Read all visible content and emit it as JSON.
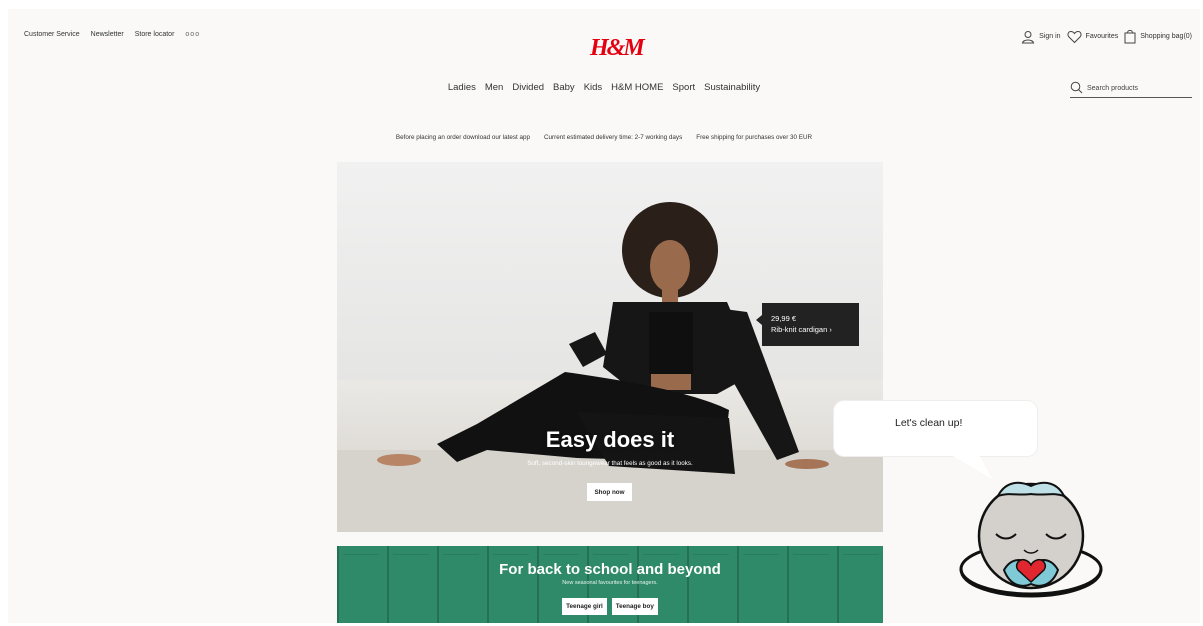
{
  "header": {
    "utility_links": [
      "Customer Service",
      "Newsletter",
      "Store locator"
    ],
    "more_label": "ooo",
    "logo": "H&M",
    "account": {
      "sign_in": "Sign in",
      "favourites": "Favourites",
      "shopping_bag": "Shopping bag(0)"
    },
    "nav": [
      "Ladies",
      "Men",
      "Divided",
      "Baby",
      "Kids",
      "H&M HOME",
      "Sport",
      "Sustainability"
    ],
    "search": {
      "placeholder": "Search products"
    }
  },
  "promo_bar": [
    "Before placing an order download our latest app",
    "Current estimated delivery time: 2-7 working days",
    "Free shipping for purchases over 30 EUR"
  ],
  "hero": {
    "title": "Easy does it",
    "subtitle": "Soft, second-skin loungewear that feels as good as it looks.",
    "cta": "Shop now",
    "price_tag": {
      "price": "29,99 €",
      "product": "Rib-knit cardigan ›"
    }
  },
  "banner2": {
    "title": "For back to school and beyond",
    "subtitle": "New seasonal favourites for teenagers.",
    "buttons": [
      "Teenage girl",
      "Teenage boy"
    ]
  },
  "chatbot": {
    "message": "Let's clean up!"
  },
  "colors": {
    "brand_red": "#e50010",
    "page_bg": "#faf9f8",
    "banner_green": "#2f8a6a",
    "price_tag_bg": "#222222"
  },
  "icons": [
    "user-icon",
    "heart-icon",
    "bag-icon",
    "search-icon",
    "mascot-icon"
  ]
}
